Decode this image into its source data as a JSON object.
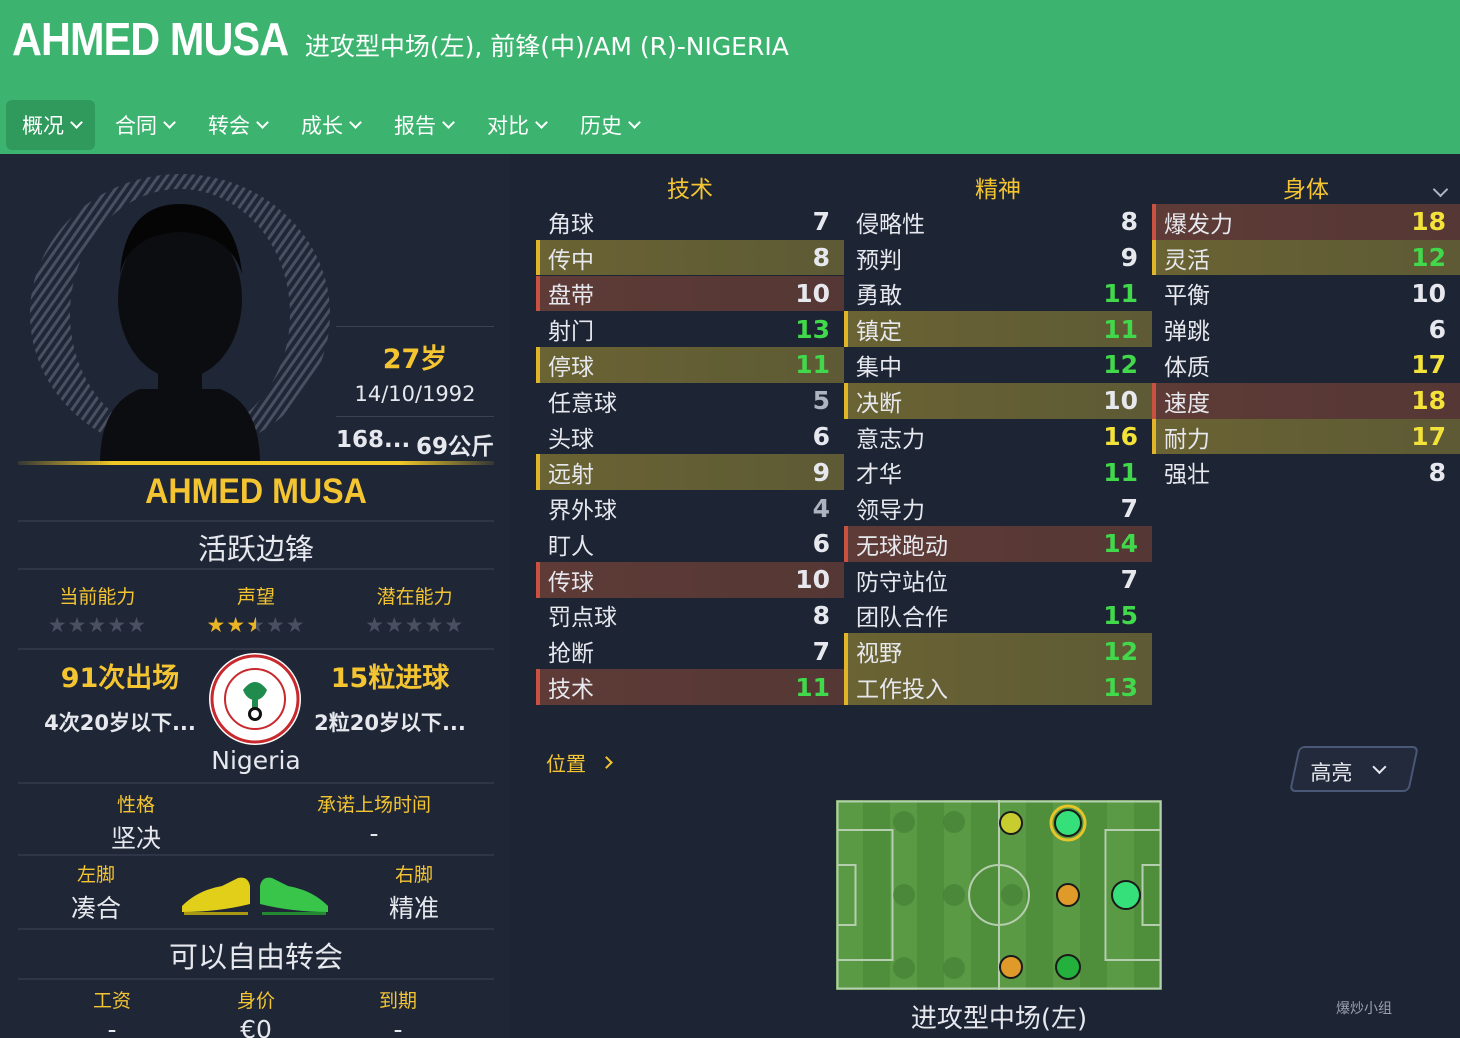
{
  "header": {
    "player_name": "AHMED MUSA",
    "positions": "进攻型中场(左), 前锋(中)/AM (R)-NIGERIA"
  },
  "nav": [
    {
      "label": "概况"
    },
    {
      "label": "合同"
    },
    {
      "label": "转会"
    },
    {
      "label": "成长"
    },
    {
      "label": "报告"
    },
    {
      "label": "对比"
    },
    {
      "label": "历史"
    }
  ],
  "profile": {
    "age": "27岁",
    "dob": "14/10/1992",
    "height": "168...",
    "weight": "69公斤",
    "name": "AHMED MUSA",
    "role": "活跃边锋",
    "ratings": {
      "current_label": "当前能力",
      "current_stars": 0,
      "reputation_label": "声望",
      "reputation_stars": 2.5,
      "potential_label": "潜在能力",
      "potential_stars": 0
    },
    "apps_big": "91次出场",
    "apps_small": "4次20岁以下...",
    "goals_big": "15粒进球",
    "goals_small": "2粒20岁以下...",
    "nation": "Nigeria",
    "badge_text_top": "NIGERIA FOOTBALL ASSOCIATION",
    "badge_text_bottom": "ABUJA",
    "personality_label": "性格",
    "personality_value": "坚决",
    "playing_time_label": "承诺上场时间",
    "playing_time_value": "-",
    "left_foot_label": "左脚",
    "left_foot_value": "凑合",
    "right_foot_label": "右脚",
    "right_foot_value": "精准",
    "transfer_status": "可以自由转会",
    "wage_label": "工资",
    "wage_value": "-",
    "value_label": "身价",
    "value_value": "€0",
    "expiry_label": "到期",
    "expiry_value": "-"
  },
  "attributes": {
    "technical_title": "技术",
    "mental_title": "精神",
    "physical_title": "身体",
    "technical": [
      {
        "name": "角球",
        "value": "7",
        "hl": ""
      },
      {
        "name": "传中",
        "value": "8",
        "hl": "gold"
      },
      {
        "name": "盘带",
        "value": "10",
        "hl": "red"
      },
      {
        "name": "射门",
        "value": "13",
        "hl": ""
      },
      {
        "name": "停球",
        "value": "11",
        "hl": "gold"
      },
      {
        "name": "任意球",
        "value": "5",
        "hl": ""
      },
      {
        "name": "头球",
        "value": "6",
        "hl": ""
      },
      {
        "name": "远射",
        "value": "9",
        "hl": "gold"
      },
      {
        "name": "界外球",
        "value": "4",
        "hl": ""
      },
      {
        "name": "盯人",
        "value": "6",
        "hl": ""
      },
      {
        "name": "传球",
        "value": "10",
        "hl": "red"
      },
      {
        "name": "罚点球",
        "value": "8",
        "hl": ""
      },
      {
        "name": "抢断",
        "value": "7",
        "hl": ""
      },
      {
        "name": "技术",
        "value": "11",
        "hl": "red"
      }
    ],
    "mental": [
      {
        "name": "侵略性",
        "value": "8",
        "hl": ""
      },
      {
        "name": "预判",
        "value": "9",
        "hl": ""
      },
      {
        "name": "勇敢",
        "value": "11",
        "hl": ""
      },
      {
        "name": "镇定",
        "value": "11",
        "hl": "gold"
      },
      {
        "name": "集中",
        "value": "12",
        "hl": ""
      },
      {
        "name": "决断",
        "value": "10",
        "hl": "gold"
      },
      {
        "name": "意志力",
        "value": "16",
        "hl": ""
      },
      {
        "name": "才华",
        "value": "11",
        "hl": ""
      },
      {
        "name": "领导力",
        "value": "7",
        "hl": ""
      },
      {
        "name": "无球跑动",
        "value": "14",
        "hl": "red"
      },
      {
        "name": "防守站位",
        "value": "7",
        "hl": ""
      },
      {
        "name": "团队合作",
        "value": "15",
        "hl": ""
      },
      {
        "name": "视野",
        "value": "12",
        "hl": "gold"
      },
      {
        "name": "工作投入",
        "value": "13",
        "hl": "gold"
      }
    ],
    "physical": [
      {
        "name": "爆发力",
        "value": "18",
        "hl": "red"
      },
      {
        "name": "灵活",
        "value": "12",
        "hl": "gold"
      },
      {
        "name": "平衡",
        "value": "10",
        "hl": ""
      },
      {
        "name": "弹跳",
        "value": "6",
        "hl": ""
      },
      {
        "name": "体质",
        "value": "17",
        "hl": ""
      },
      {
        "name": "速度",
        "value": "18",
        "hl": "red"
      },
      {
        "name": "耐力",
        "value": "17",
        "hl": "gold"
      },
      {
        "name": "强壮",
        "value": "8",
        "hl": ""
      }
    ]
  },
  "position_section": {
    "link_label": "位置",
    "highlight_label": "高亮",
    "position_name": "进攻型中场(左)"
  },
  "colors": {
    "header_green": "#3cb46f",
    "accent_gold": "#f4c531",
    "value_green": "#41d94b",
    "value_yellow": "#f3e23a"
  },
  "watermark": "爆炒小组"
}
